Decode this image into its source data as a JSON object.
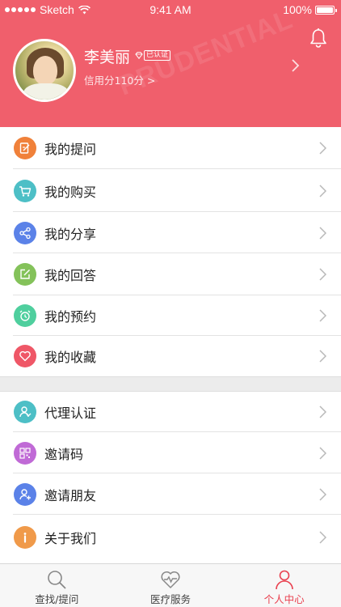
{
  "status_bar": {
    "carrier": "Sketch",
    "time": "9:41 AM",
    "battery": "100%"
  },
  "header": {
    "user_name": "李美丽",
    "verified_label": "已认证",
    "credit": "信用分110分 >",
    "background_color": "#f05f6c"
  },
  "menu_group_1": [
    {
      "label": "我的提问",
      "icon": "question-edit-icon",
      "color": "#f0813a"
    },
    {
      "label": "我的购买",
      "icon": "cart-icon",
      "color": "#4dbfc6"
    },
    {
      "label": "我的分享",
      "icon": "share-icon",
      "color": "#5b82e8"
    },
    {
      "label": "我的回答",
      "icon": "answer-edit-icon",
      "color": "#84c25a"
    },
    {
      "label": "我的预约",
      "icon": "alarm-clock-icon",
      "color": "#4fcf9e"
    },
    {
      "label": "我的收藏",
      "icon": "heart-icon",
      "color": "#ef5767"
    }
  ],
  "menu_group_2": [
    {
      "label": "代理认证",
      "icon": "agent-verify-icon",
      "color": "#4dbfc6"
    },
    {
      "label": "邀请码",
      "icon": "qr-code-icon",
      "color": "#c06ad6"
    },
    {
      "label": "邀请朋友",
      "icon": "add-friend-icon",
      "color": "#5b82e8"
    },
    {
      "label": "关于我们",
      "icon": "info-icon",
      "color": "#f09a4a"
    }
  ],
  "tabs": [
    {
      "label": "查找/提问",
      "icon": "search-icon",
      "active": false
    },
    {
      "label": "医疗服务",
      "icon": "heart-pulse-icon",
      "active": false
    },
    {
      "label": "个人中心",
      "icon": "person-icon",
      "active": true
    }
  ]
}
